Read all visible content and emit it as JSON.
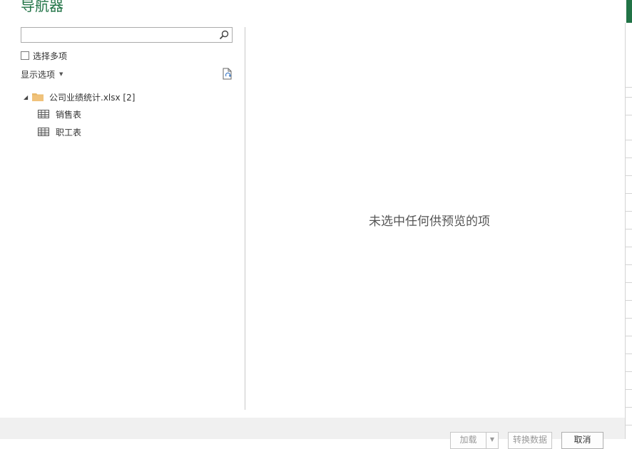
{
  "window": {
    "title": "导航器"
  },
  "search": {
    "value": "",
    "placeholder": ""
  },
  "multi_select": {
    "label": "选择多项",
    "checked": false
  },
  "display_options": {
    "label": "显示选项"
  },
  "tree": {
    "root": {
      "label": "公司业绩统计.xlsx [2]",
      "expanded": true
    },
    "items": [
      {
        "label": "销售表",
        "icon": "table-icon"
      },
      {
        "label": "职工表",
        "icon": "table-icon"
      }
    ]
  },
  "preview": {
    "empty_message": "未选中任何供预览的项"
  },
  "footer": {
    "load_label": "加载",
    "transform_label": "转换数据",
    "cancel_label": "取消"
  },
  "colors": {
    "accent": "#217346",
    "folder": "#e8b86a"
  }
}
